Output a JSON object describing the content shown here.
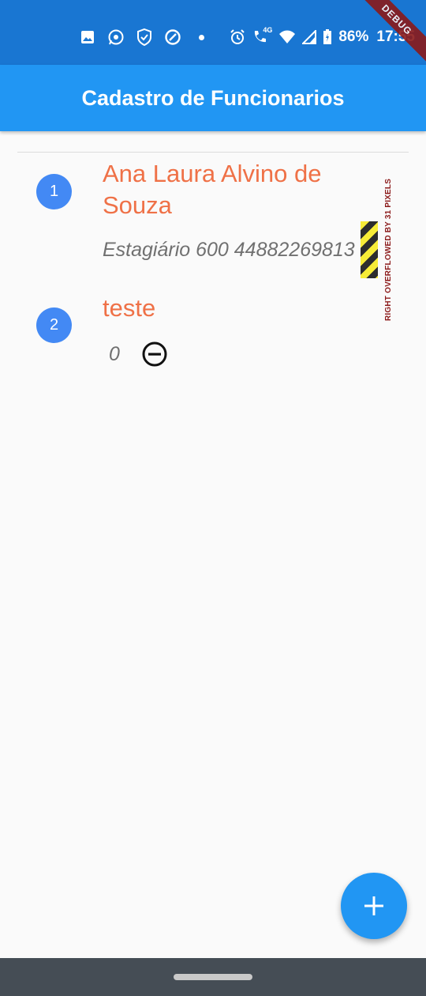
{
  "status_bar": {
    "battery": "86%",
    "time": "17:55",
    "network": "4G",
    "left_icons": [
      "image-icon",
      "whatsapp-icon",
      "shield-icon",
      "data-saver-icon",
      "dot-icon"
    ],
    "right_icons": [
      "alarm-icon",
      "call-icon",
      "wifi-icon",
      "signal-icon",
      "battery-icon"
    ]
  },
  "debug_banner": "DEBUG",
  "app_bar": {
    "title": "Cadastro de Funcionarios"
  },
  "employees": [
    {
      "index": "1",
      "name": "Ana Laura Alvino de Souza",
      "details": "Estagiário 600 44882269813"
    },
    {
      "index": "2",
      "name": "teste",
      "details": "0"
    }
  ],
  "overflow_warning": "RIGHT OVERFLOWED BY 31 PIXELS",
  "colors": {
    "status_bar": "#1976d2",
    "app_bar": "#2196f3",
    "badge": "#4389f4",
    "name_text": "#ef7147",
    "fab": "#2196f3"
  },
  "fab": {
    "icon": "plus-icon"
  }
}
